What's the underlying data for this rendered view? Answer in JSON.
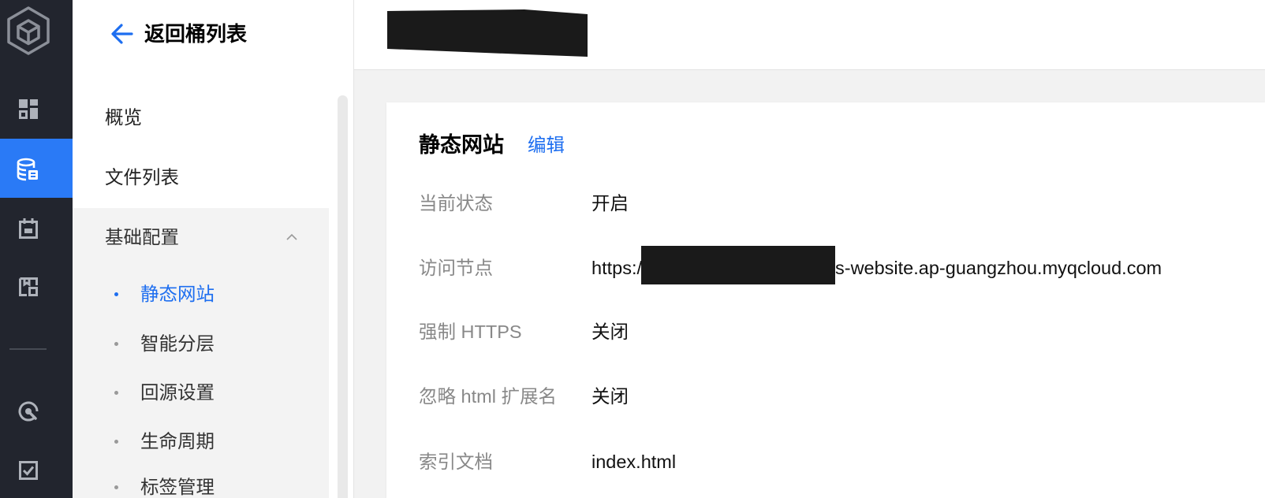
{
  "colors": {
    "accent": "#1d6ef0",
    "rail_background": "#22252e",
    "rail_active": "#2a7af6",
    "page_background": "#f2f2f2",
    "label_text": "#888888"
  },
  "nav_rail": {
    "logo_icon": "hexagon-cube-logo-icon",
    "items": [
      {
        "icon": "dashboard-icon",
        "active": false
      },
      {
        "icon": "database-bucket-icon",
        "active": true
      },
      {
        "icon": "calendar-icon",
        "active": false
      },
      {
        "icon": "storage-box-icon",
        "active": false
      },
      {
        "icon": "gauge-icon",
        "active": false
      },
      {
        "icon": "checkbox-icon",
        "active": false
      }
    ]
  },
  "sidebar": {
    "back": {
      "icon": "arrow-left-icon",
      "label": "返回桶列表"
    },
    "items": [
      {
        "label": "概览"
      },
      {
        "label": "文件列表"
      }
    ],
    "group": {
      "label": "基础配置",
      "expanded": true,
      "chevron_icon": "chevron-up-icon",
      "items": [
        {
          "label": "静态网站",
          "active": true
        },
        {
          "label": "智能分层",
          "active": false
        },
        {
          "label": "回源设置",
          "active": false
        },
        {
          "label": "生命周期",
          "active": false
        },
        {
          "label": "标签管理",
          "active": false
        }
      ]
    }
  },
  "card": {
    "title": "静态网站",
    "edit_label": "编辑",
    "rows": [
      {
        "label": "当前状态",
        "value": "开启"
      },
      {
        "label": "访问节点",
        "value_prefix": "https:/",
        "value_suffix": "s-website.ap-guangzhou.myqcloud.com"
      },
      {
        "label": "强制 HTTPS",
        "value": "关闭"
      },
      {
        "label": "忽略 html 扩展名",
        "value": "关闭"
      },
      {
        "label": "索引文档",
        "value": "index.html"
      }
    ]
  }
}
